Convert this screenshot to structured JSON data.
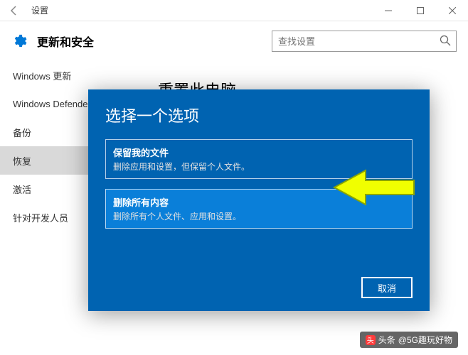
{
  "titlebar": {
    "title": "设置"
  },
  "header": {
    "title": "更新和安全",
    "search_placeholder": "查找设置"
  },
  "sidebar": {
    "items": [
      {
        "label": "Windows 更新"
      },
      {
        "label": "Windows Defender"
      },
      {
        "label": "备份"
      },
      {
        "label": "恢复"
      },
      {
        "label": "激活"
      },
      {
        "label": "针对开发人员"
      }
    ],
    "active_index": 3
  },
  "content": {
    "title": "重置此电脑"
  },
  "dialog": {
    "title": "选择一个选项",
    "options": [
      {
        "title": "保留我的文件",
        "desc": "删除应用和设置，但保留个人文件。"
      },
      {
        "title": "删除所有内容",
        "desc": "删除所有个人文件、应用和设置。"
      }
    ],
    "highlight_index": 1,
    "cancel": "取消"
  },
  "watermark": {
    "prefix": "头条",
    "text": "@5G趣玩好物"
  }
}
